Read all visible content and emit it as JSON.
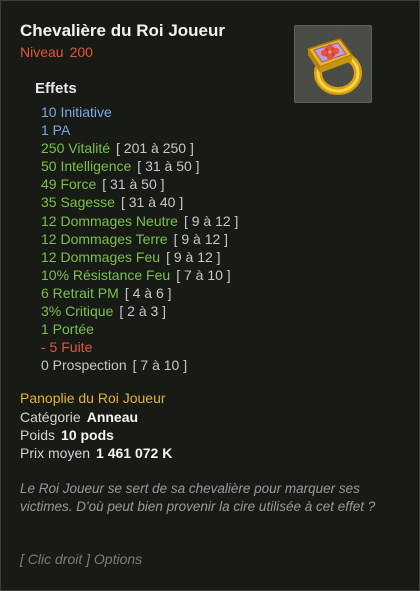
{
  "item": {
    "name": "Chevalière du Roi Joueur",
    "level_label": "Niveau",
    "level_value": "200",
    "image_icon": "golden-ring-icon"
  },
  "effects": {
    "title": "Effets",
    "lines": [
      {
        "text": "10 Initiative",
        "range": "",
        "color": "#7fa8e6"
      },
      {
        "text": "1 PA",
        "range": "",
        "color": "#7fa8e6"
      },
      {
        "text": "250 Vitalité",
        "range": "[ 201 à 250 ]",
        "color": "#7bc04d"
      },
      {
        "text": "50 Intelligence",
        "range": "[ 31 à 50 ]",
        "color": "#7bc04d"
      },
      {
        "text": "49 Force",
        "range": "[ 31 à 50 ]",
        "color": "#7bc04d"
      },
      {
        "text": "35 Sagesse",
        "range": "[ 31 à 40 ]",
        "color": "#7bc04d"
      },
      {
        "text": "12 Dommages Neutre",
        "range": "[ 9 à 12 ]",
        "color": "#7bc04d"
      },
      {
        "text": "12 Dommages Terre",
        "range": "[ 9 à 12 ]",
        "color": "#7bc04d"
      },
      {
        "text": "12 Dommages Feu",
        "range": "[ 9 à 12 ]",
        "color": "#7bc04d"
      },
      {
        "text": "10% Résistance Feu",
        "range": "[ 7 à 10 ]",
        "color": "#7bc04d"
      },
      {
        "text": "6 Retrait PM",
        "range": "[ 4 à 6 ]",
        "color": "#7bc04d"
      },
      {
        "text": "3% Critique",
        "range": "[ 2 à 3 ]",
        "color": "#7bc04d"
      },
      {
        "text": "1 Portée",
        "range": "",
        "color": "#7bc04d"
      },
      {
        "text": "- 5 Fuite",
        "range": "",
        "color": "#e05840"
      },
      {
        "text": "0 Prospection",
        "range": "[ 7 à 10 ]",
        "color": "#c8c8c8"
      }
    ]
  },
  "panoply": "Panoplie du Roi Joueur",
  "properties": {
    "category_label": "Catégorie",
    "category_value": "Anneau",
    "weight_label": "Poids",
    "weight_value": "10 pods",
    "price_label": "Prix moyen",
    "price_value": "1 461 072 K"
  },
  "description": "Le Roi Joueur se sert de sa chevalière pour marquer ses victimes. D'où peut bien provenir la cire utilisée à cet effet ?",
  "options_hint": "[ Clic droit ] Options"
}
